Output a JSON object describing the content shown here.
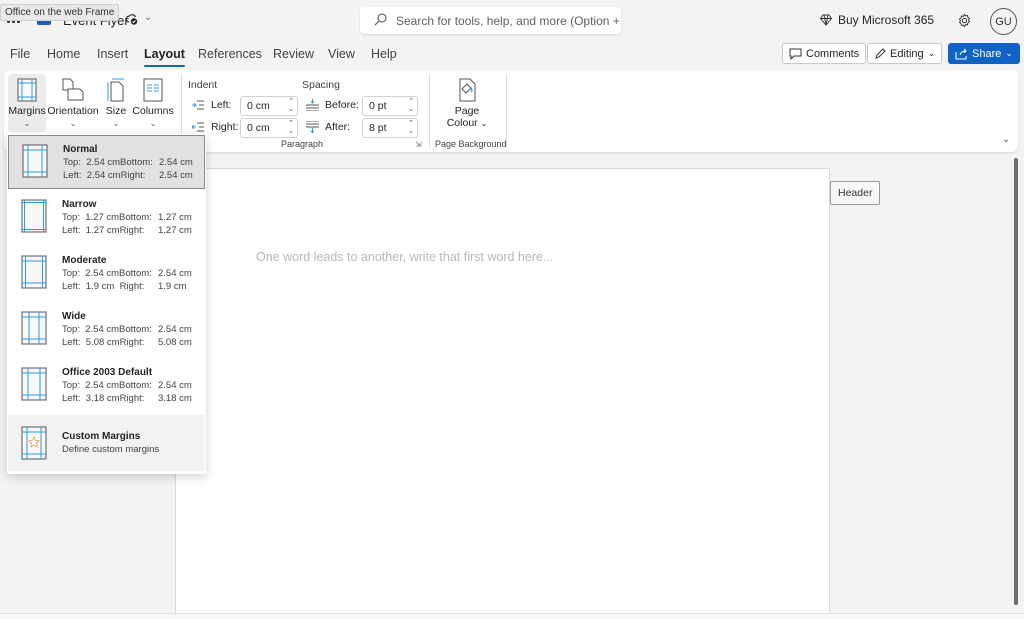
{
  "titlebar": {
    "tooltip": "Office on the web Frame",
    "doc_title": "Event Flyer",
    "search_placeholder": "Search for tools, help, and more (Option + Q)",
    "buy_label": "Buy Microsoft 365",
    "avatar_initials": "GU"
  },
  "menu": {
    "tabs": [
      {
        "label": "File"
      },
      {
        "label": "Home"
      },
      {
        "label": "Insert"
      },
      {
        "label": "Layout",
        "active": true
      },
      {
        "label": "References"
      },
      {
        "label": "Review"
      },
      {
        "label": "View"
      },
      {
        "label": "Help"
      }
    ],
    "comments_label": "Comments",
    "editing_label": "Editing",
    "share_label": "Share"
  },
  "ribbon": {
    "page_setup": {
      "margins": "Margins",
      "orientation": "Orientation",
      "size": "Size",
      "columns": "Columns"
    },
    "paragraph": {
      "indent_title": "Indent",
      "spacing_title": "Spacing",
      "left_label": "Left:",
      "left_value": "0 cm",
      "right_label": "Right:",
      "right_value": "0 cm",
      "before_label": "Before:",
      "before_value": "0 pt",
      "after_label": "After:",
      "after_value": "8 pt",
      "group_label": "Paragraph"
    },
    "page_background": {
      "page_colour_line1": "Page",
      "page_colour_line2": "Colour",
      "group_label": "Page Background"
    }
  },
  "document": {
    "placeholder": "One word leads to another, write that first word here...",
    "header_tag": "Header"
  },
  "margins_menu": {
    "items": [
      {
        "name": "Normal",
        "top_label": "Top:",
        "top": "2.54 cm",
        "bottom_label": "Bottom:",
        "bottom": "2.54 cm",
        "left_label": "Left:",
        "left": "2.54 cm",
        "right_label": "Right:",
        "right": "2.54 cm",
        "selected": true
      },
      {
        "name": "Narrow",
        "top_label": "Top:",
        "top": "1.27 cm",
        "bottom_label": "Bottom:",
        "bottom": "1.27 cm",
        "left_label": "Left:",
        "left": "1.27 cm",
        "right_label": "Right:",
        "right": "1.27 cm"
      },
      {
        "name": "Moderate",
        "top_label": "Top:",
        "top": "2.54 cm",
        "bottom_label": "Bottom:",
        "bottom": "2.54 cm",
        "left_label": "Left:",
        "left": "1.9 cm",
        "right_label": "Right:",
        "right": "1.9 cm"
      },
      {
        "name": "Wide",
        "top_label": "Top:",
        "top": "2.54 cm",
        "bottom_label": "Bottom:",
        "bottom": "2.54 cm",
        "left_label": "Left:",
        "left": "5.08 cm",
        "right_label": "Right:",
        "right": "5.08 cm"
      },
      {
        "name": "Office 2003 Default",
        "top_label": "Top:",
        "top": "2.54 cm",
        "bottom_label": "Bottom:",
        "bottom": "2.54 cm",
        "left_label": "Left:",
        "left": "3.18 cm",
        "right_label": "Right:",
        "right": "3.18 cm"
      }
    ],
    "custom": {
      "name": "Custom Margins",
      "description": "Define custom margins"
    }
  },
  "colors": {
    "accent": "#0f6cbd",
    "share_button": "#1062c4",
    "margin_guide": "#2a9ce0",
    "custom_star": "#f0a050"
  }
}
